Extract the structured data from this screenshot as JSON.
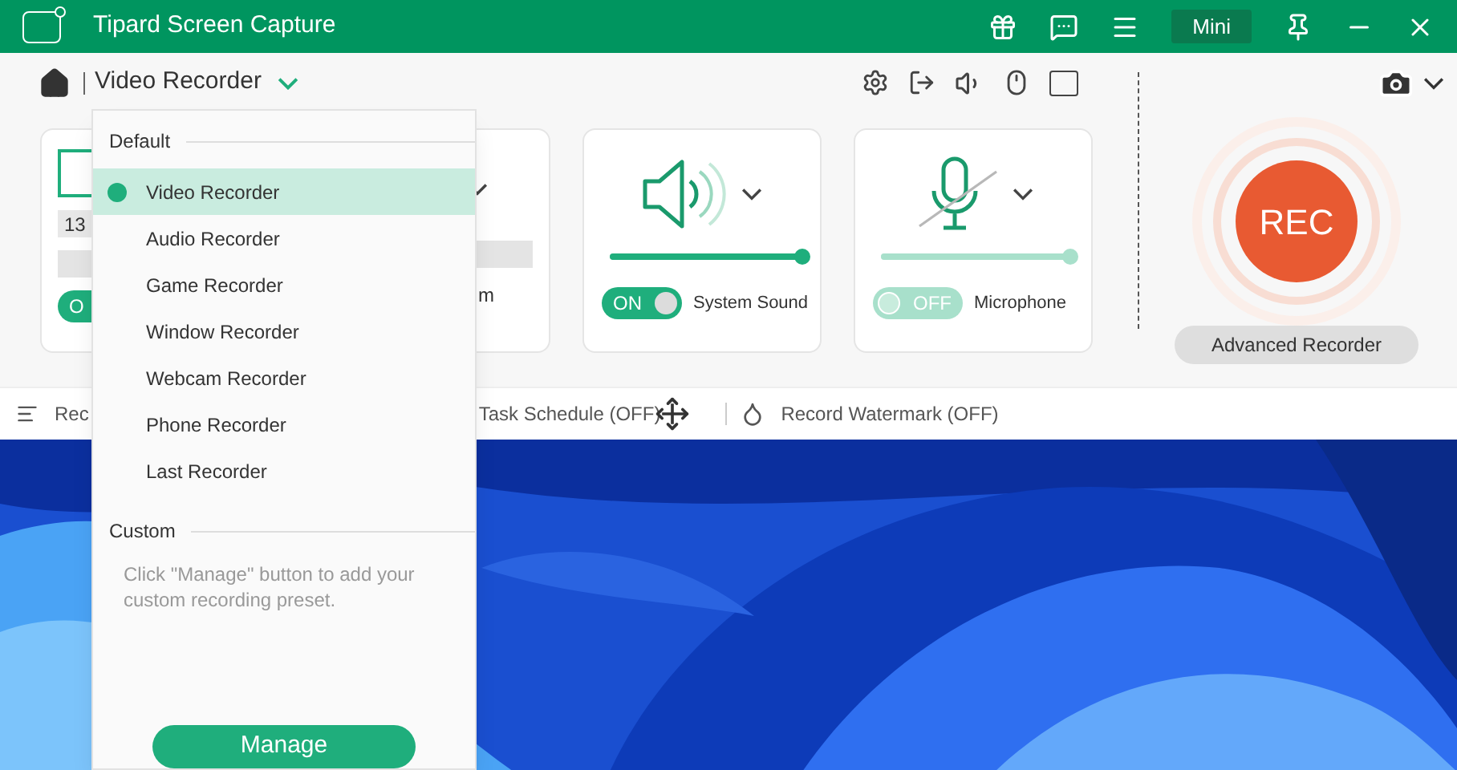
{
  "window": {
    "title": "Tipard Screen Capture",
    "mini_button": "Mini"
  },
  "mode": {
    "label": "Video Recorder"
  },
  "cards": [
    {
      "kind": "screen",
      "size_text": "13",
      "toggle": {
        "on": true,
        "text": "O"
      }
    },
    {
      "kind": "webcam",
      "label": "m"
    },
    {
      "kind": "speaker",
      "level": 1,
      "toggle": {
        "on": true,
        "text": "ON"
      },
      "label": "System Sound"
    },
    {
      "kind": "mic",
      "level": 0.98,
      "toggle": {
        "on": false,
        "text": "OFF"
      },
      "label": "Microphone"
    }
  ],
  "rec": {
    "label": "REC",
    "advanced": "Advanced Recorder"
  },
  "bottom_bar": [
    {
      "kind": "list",
      "label": "Rec"
    },
    {
      "kind": "schedule",
      "label": "Task Schedule (OFF)"
    },
    {
      "kind": "watermark",
      "label": "Record Watermark (OFF)"
    }
  ],
  "dropdown": {
    "default_title": "Default",
    "items": [
      {
        "label": "Video Recorder",
        "selected": true
      },
      {
        "label": "Audio Recorder",
        "selected": false
      },
      {
        "label": "Game Recorder",
        "selected": false
      },
      {
        "label": "Window Recorder",
        "selected": false
      },
      {
        "label": "Webcam Recorder",
        "selected": false
      },
      {
        "label": "Phone Recorder",
        "selected": false
      },
      {
        "label": "Last Recorder",
        "selected": false
      }
    ],
    "custom_title": "Custom",
    "custom_note": "Click \"Manage\" button to add your custom recording preset.",
    "manage": "Manage"
  }
}
